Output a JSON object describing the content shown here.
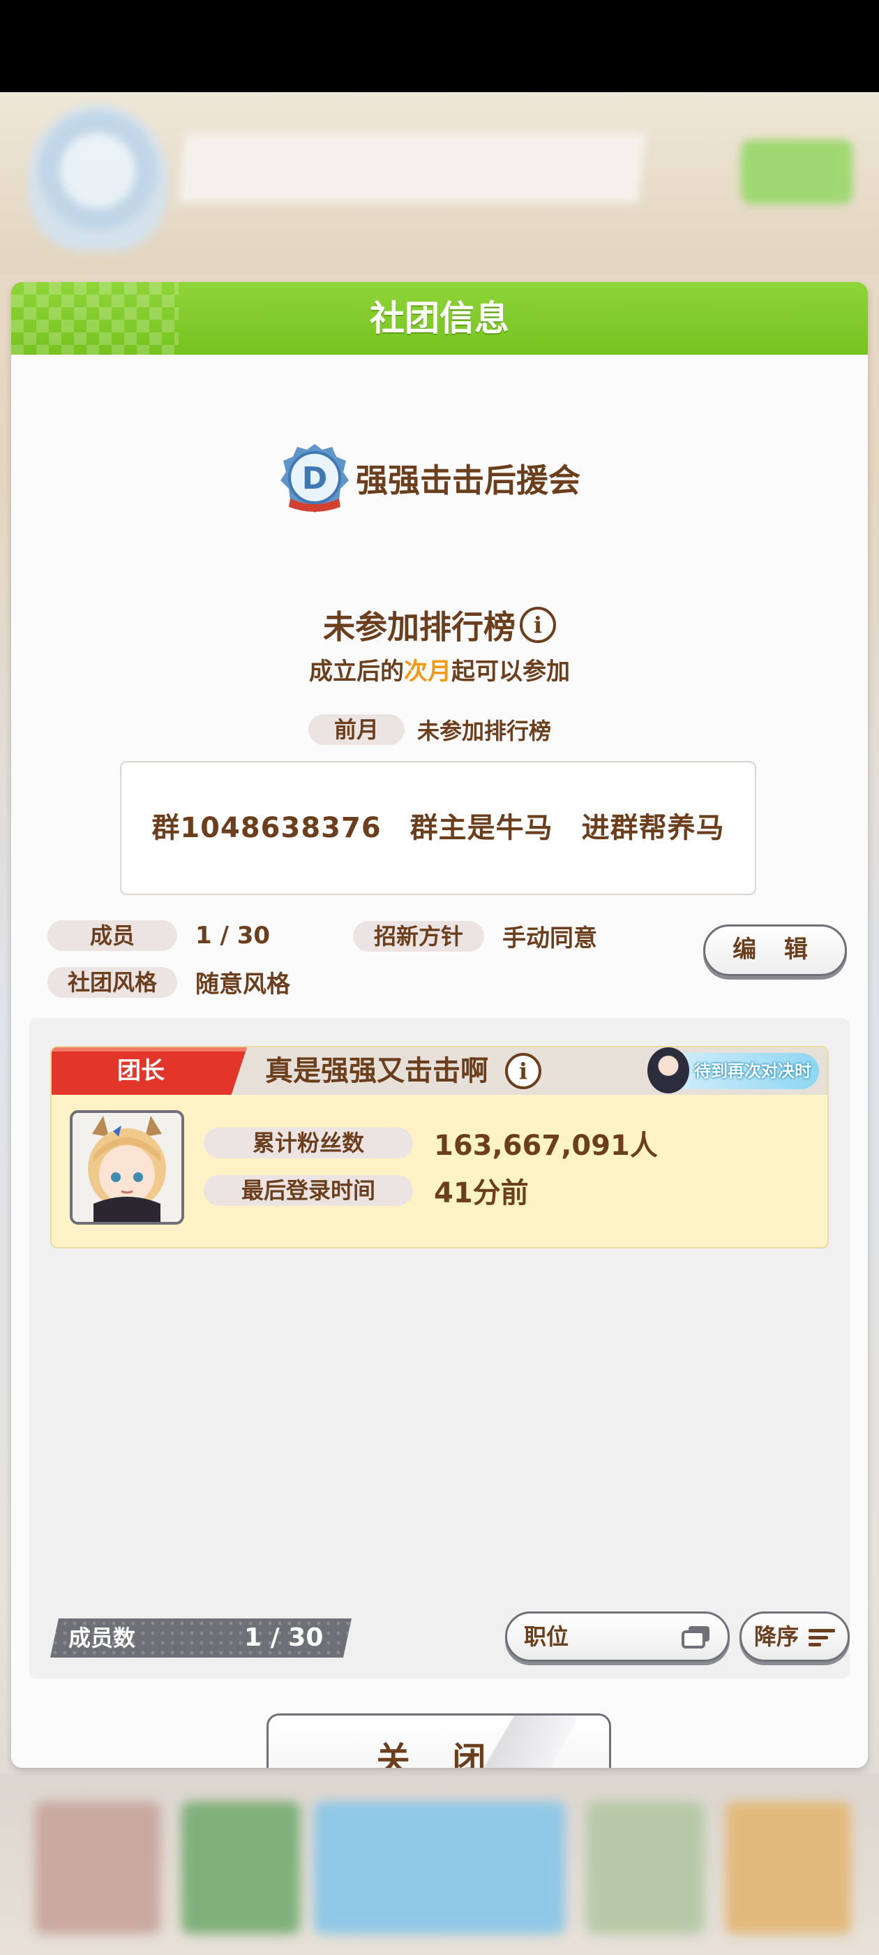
{
  "dialog": {
    "title": "社团信息",
    "club_name": "强强击击后援会"
  },
  "ranking": {
    "status_title": "未参加排行榜",
    "sub_prefix": "成立后的",
    "sub_highlight": "次月",
    "sub_suffix": "起可以参加",
    "prev_label": "前月",
    "prev_value": "未参加排行榜"
  },
  "description": "群1048638376　群主是牛马　进群帮养马",
  "club_info": {
    "members_label": "成员",
    "members_value": "1 / 30",
    "policy_label": "招新方针",
    "policy_value": "手动同意",
    "style_label": "社团风格",
    "style_value": "随意风格",
    "edit_label": "编 辑"
  },
  "leader_card": {
    "role": "团长",
    "name": "真是强强又击击啊",
    "rematch_badge": "待到再次对决时",
    "fans_label": "累计粉丝数",
    "fans_value": "163,667,091人",
    "last_login_label": "最后登录时间",
    "last_login_value": "41分前"
  },
  "footer": {
    "count_label": "成员数",
    "count_value": "1 / 30",
    "sort_by_label": "职位",
    "order_label": "降序",
    "close_label": "关 闭"
  },
  "colors": {
    "header_green": "#76c21e",
    "text_brown": "#6b3f1d",
    "highlight_orange": "#f29a17",
    "leader_red": "#e3362a"
  }
}
